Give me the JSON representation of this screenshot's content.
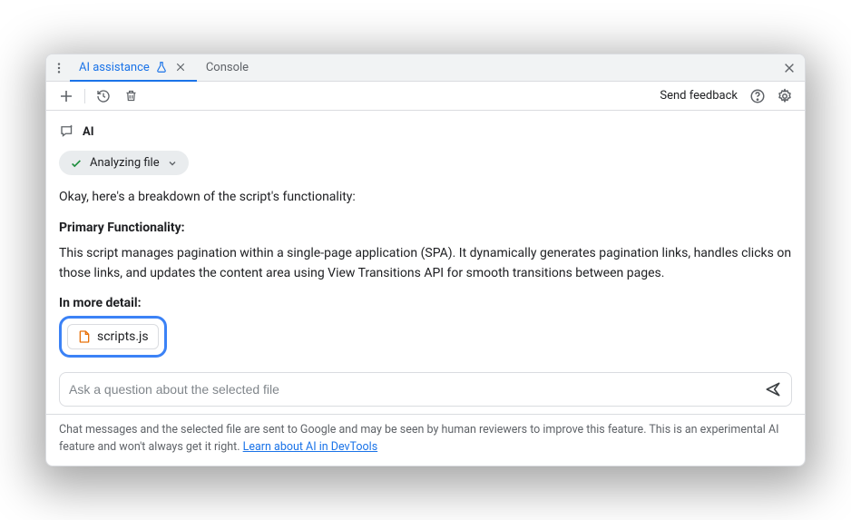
{
  "tabs": {
    "ai": "AI assistance",
    "console": "Console"
  },
  "toolbar": {
    "feedback": "Send feedback"
  },
  "ai": {
    "label": "AI"
  },
  "chip": {
    "text": "Analyzing file"
  },
  "body": {
    "intro": "Okay, here's a breakdown of the script's functionality:",
    "h1": "Primary Functionality:",
    "p1": "This script manages pagination within a single-page application (SPA). It dynamically generates pagination links, handles clicks on those links, and updates the content area using View Transitions API for smooth transitions between pages.",
    "h2": "In more detail:"
  },
  "file": {
    "name": "scripts.js"
  },
  "input": {
    "placeholder": "Ask a question about the selected file"
  },
  "footer": {
    "text": "Chat messages and the selected file are sent to Google and may be seen by human reviewers to improve this feature. This is an experimental AI feature and won't always get it right. ",
    "link": "Learn about AI in DevTools"
  }
}
